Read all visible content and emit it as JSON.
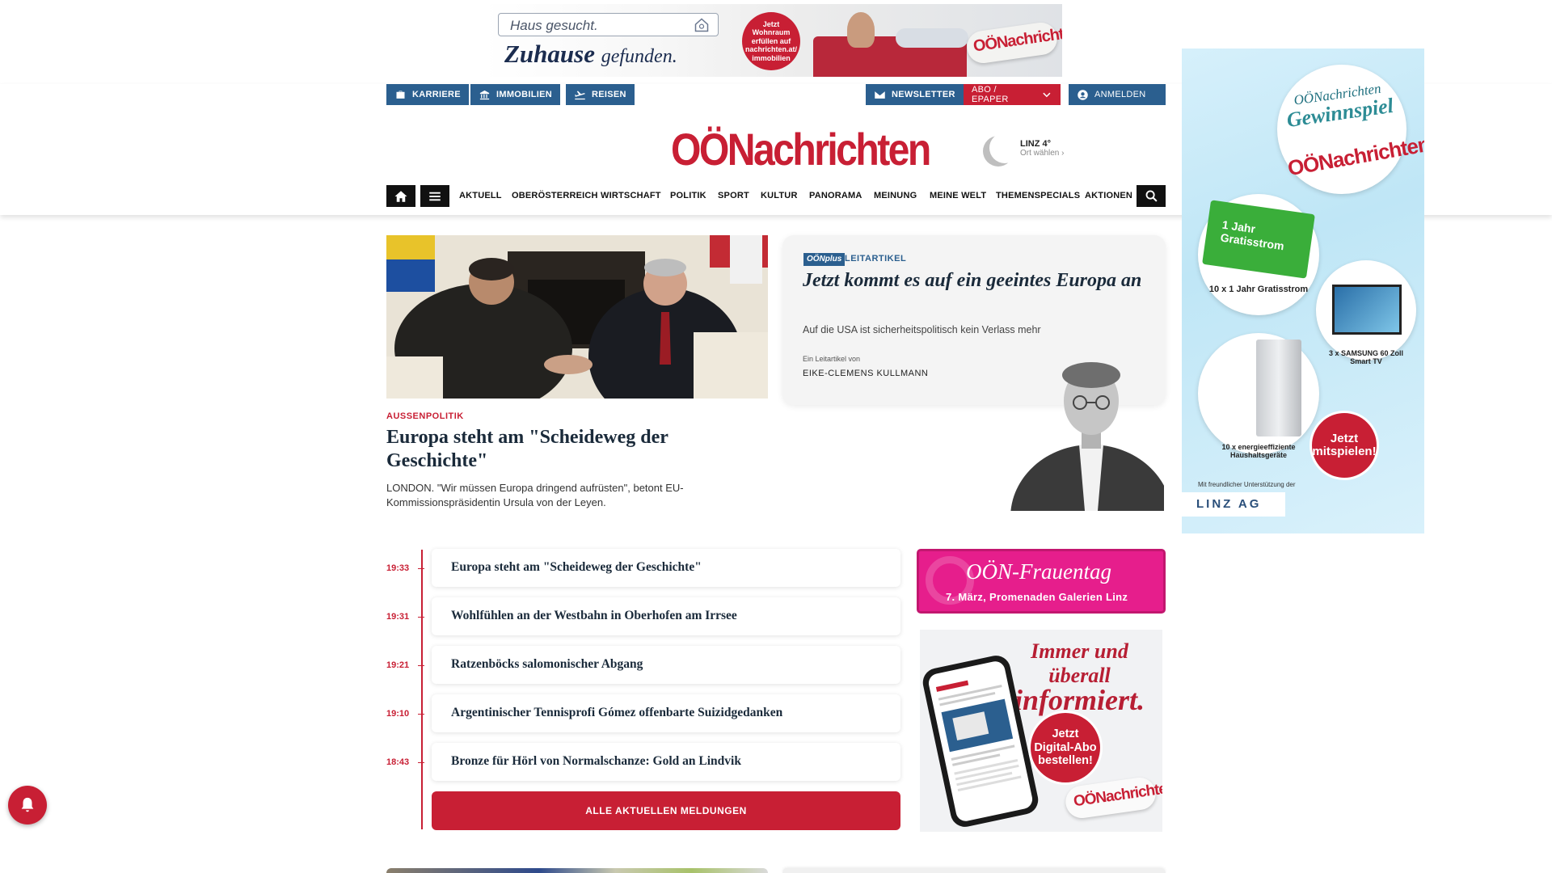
{
  "top_ad": {
    "search_placeholder": "Haus gesucht.",
    "slogan_main": "Zuhause",
    "slogan_small": "gefunden.",
    "badge": "Jetzt Wohnraum erfüllen auf nachrichten.at/ immobilien",
    "logo": "OÖNachrichten"
  },
  "utility": {
    "karriere": "KARRIERE",
    "immobilien": "IMMOBILIEN",
    "reisen": "REISEN",
    "newsletter": "NEWSLETTER",
    "abo": "ABO / EPAPER",
    "anmelden": "ANMELDEN"
  },
  "logo": "OÖNachrichten",
  "weather": {
    "city": "LINZ 4°",
    "select": "Ort wählen"
  },
  "nav": {
    "items": [
      "AKTUELL",
      "OBERÖSTERREICH",
      "WIRTSCHAFT",
      "POLITIK",
      "SPORT",
      "KULTUR",
      "PANORAMA",
      "MEINUNG",
      "MEINE WELT",
      "THEMENSPECIALS",
      "AKTIONEN"
    ]
  },
  "lead": {
    "category": "AUSSENPOLITIK",
    "title": "Europa steht am \"Scheideweg der Geschichte\"",
    "teaser": "LONDON. \"Wir müssen Europa dringend aufrüsten\", betont EU-Kommissionspräsidentin Ursula von der Leyen."
  },
  "editorial": {
    "badge": "OÖNplus",
    "category": "LEITARTIKEL",
    "title": "Jetzt kommt es auf ein geeintes Europa an",
    "subtitle": "Auf die USA ist sicherheitspolitisch kein Verlass mehr",
    "byline": "Ein Leitartikel von",
    "author": "EIKE-CLEMENS KULLMANN"
  },
  "timeline": {
    "items": [
      {
        "time": "19:33",
        "title": "Europa steht am \"Scheideweg der Geschichte\""
      },
      {
        "time": "19:31",
        "title": "Wohlfühlen an der Westbahn in Oberhofen am Irrsee"
      },
      {
        "time": "19:21",
        "title": "Ratzenböcks salomonischer Abgang"
      },
      {
        "time": "19:10",
        "title": "Argentinischer Tennisprofi Gómez offenbarte Suizidgedanken"
      },
      {
        "time": "18:43",
        "title": "Bronze für Hörl von Normalschanze: Gold an Lindvik"
      }
    ],
    "all_button": "ALLE AKTUELLEN MELDUNGEN"
  },
  "promo_frauentag": {
    "title": "OÖN-Frauentag",
    "subtitle": "7. März, Promenaden Galerien Linz"
  },
  "promo_digital": {
    "title_line1": "Immer und überall",
    "title_line2": "informiert.",
    "cta": "Jetzt Digital-Abo bestellen!",
    "logo": "OÖNachrichten"
  },
  "side_ad": {
    "title_small": "OÖNachrichten",
    "title_big": "Gewinnspiel",
    "logo": "OÖNachrichten",
    "green_box": "1 Jahr Gratisstrom",
    "prize1": "10 x 1 Jahr Gratisstrom",
    "prize2": "3 x SAMSUNG 60 Zoll Smart TV",
    "prize3": "10 x energieeffiziente Haushaltsgeräte",
    "cta": "Jetzt mitspielen!",
    "footer": "Mit freundlicher Unterstützung der",
    "sponsor": "LINZ AG"
  },
  "colors": {
    "brand_red": "#c81f34",
    "utility_blue": "#2b5f8f",
    "frauentag_pink": "#e61e8c"
  }
}
